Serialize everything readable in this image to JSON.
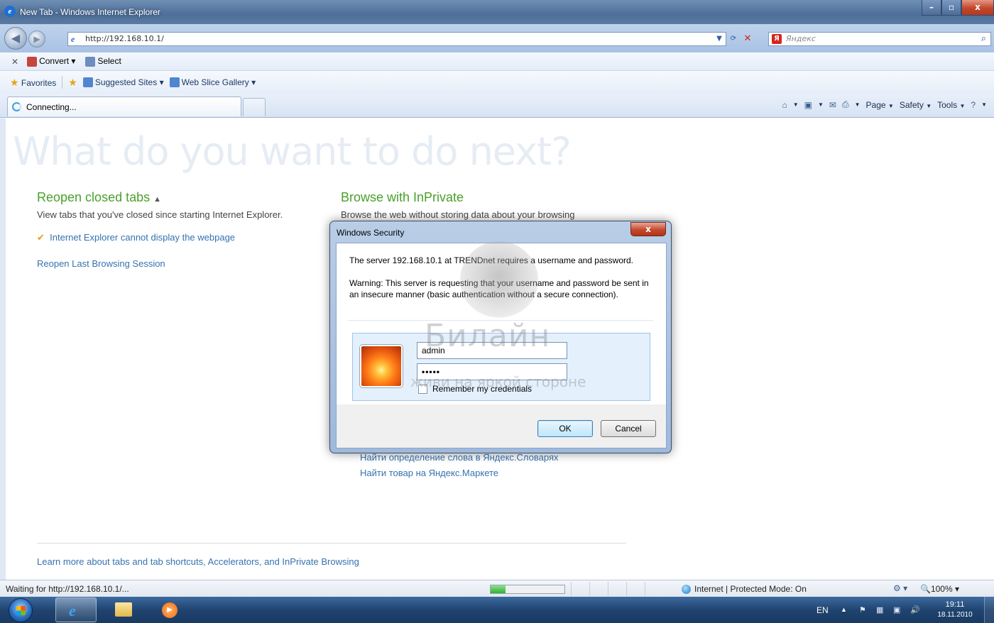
{
  "window": {
    "title": "New Tab - Windows Internet Explorer",
    "minimize": "–",
    "maximize": "▫",
    "close": "x"
  },
  "address_bar": {
    "url": "http://192.168.10.1/",
    "search_placeholder": "Яндекс",
    "search_logo": "Я"
  },
  "command_bar": {
    "convert_label": "Convert",
    "select_label": "Select"
  },
  "favorites_bar": {
    "favorites_label": "Favorites",
    "suggested_label": "Suggested Sites",
    "webslice_label": "Web Slice Gallery"
  },
  "tab": {
    "label": "Connecting..."
  },
  "tools": {
    "page_label": "Page",
    "safety_label": "Safety",
    "tools_label": "Tools"
  },
  "newtab_page": {
    "heading": "What do you want to do next?",
    "reopen_title": "Reopen closed tabs",
    "reopen_desc": "View tabs that you've closed since starting Internet Explorer.",
    "closed_tab_link": "Internet Explorer cannot display the webpage",
    "reopen_session_link": "Reopen Last Browsing Session",
    "inprivate_title": "Browse with InPrivate",
    "inprivate_desc": "Browse the web without storing data about your browsing",
    "yandex_link_1": "Найти определение слова в Яндекс.Словарях",
    "yandex_link_2": "Найти товар на Яндекс.Маркете",
    "learn_more_link": "Learn more about tabs and tab shortcuts, Accelerators, and InPrivate Browsing"
  },
  "dialog": {
    "title": "Windows Security",
    "close": "x",
    "server_message": "The server 192.168.10.1 at TRENDnet requires a username and password.",
    "warning": "Warning: This server is requesting that your username and password be sent in an insecure manner (basic authentication without a secure connection).",
    "username_value": "admin",
    "password_value": "•••••",
    "remember_label": "Remember my credentials",
    "ok_label": "OK",
    "cancel_label": "Cancel"
  },
  "watermark": {
    "brand": "Билайн",
    "tagline": "живи на яркой стороне"
  },
  "status_bar": {
    "text": "Waiting for http://192.168.10.1/...",
    "progress": 0.2,
    "zone": "Internet | Protected Mode: On",
    "zoom": "100%"
  },
  "taskbar": {
    "lang": "EN",
    "time": "19:11",
    "date": "18.11.2010"
  },
  "colors": {
    "section_heading": "#4aa02c",
    "link": "#3572b0",
    "titlebar": "#4e6f98",
    "close_button": "#c5482d"
  }
}
